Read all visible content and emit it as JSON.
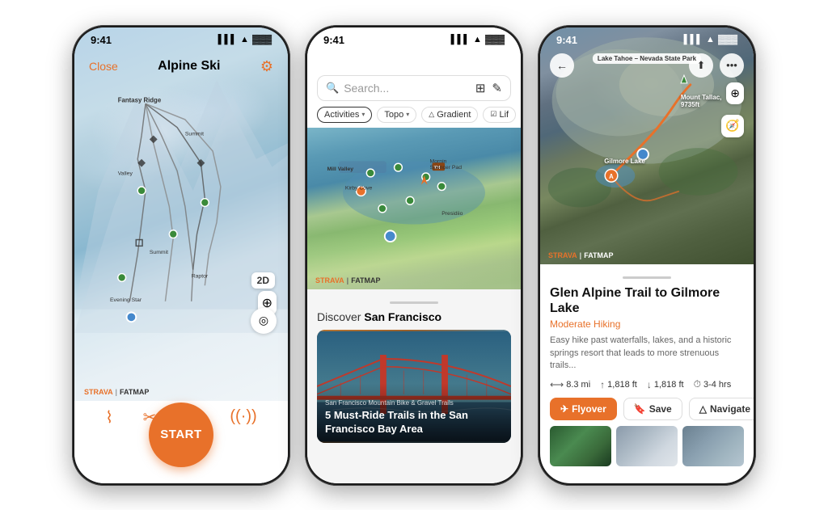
{
  "phone1": {
    "status_time": "9:41",
    "close_label": "Close",
    "title": "Alpine Ski",
    "badge_2d": "2D",
    "start_label": "START",
    "strava_label": "STRAVA",
    "divider_label": "|",
    "fatmap_label": "FATMAP"
  },
  "phone2": {
    "status_time": "9:41",
    "search_placeholder": "Search...",
    "filter_activities": "Activities",
    "filter_topo": "Topo",
    "filter_gradient": "Gradient",
    "discover_prefix": "Discover ",
    "discover_city": "San Francisco",
    "card_subtitle": "San Francisco Mountain Bike & Gravel Trails",
    "card_title": "5 Must-Ride Trails in the San Francisco Bay Area",
    "strava_label": "STRAVA",
    "fatmap_label": "FATMAP"
  },
  "phone3": {
    "status_time": "9:41",
    "map_location_label": "Lake Tahoe – Nevada State Park",
    "peak_name": "Mount Tallac,",
    "peak_elevation": "9735ft",
    "lake_name": "Gilmore Lake",
    "trail_name": "Glen Alpine Trail to Gilmore Lake",
    "trail_type": "Moderate Hiking",
    "trail_desc": "Easy hike past waterfalls, lakes, and a historic springs resort that leads to more strenuous trails...",
    "stat_distance": "8.3 mi",
    "stat_gain": "1,818 ft",
    "stat_loss": "1,818 ft",
    "stat_time": "3-4 hrs",
    "btn_flyover": "Flyover",
    "btn_save": "Save",
    "btn_navigate": "Navigate",
    "strava_label": "STRAVA",
    "fatmap_label": "FATMAP"
  }
}
